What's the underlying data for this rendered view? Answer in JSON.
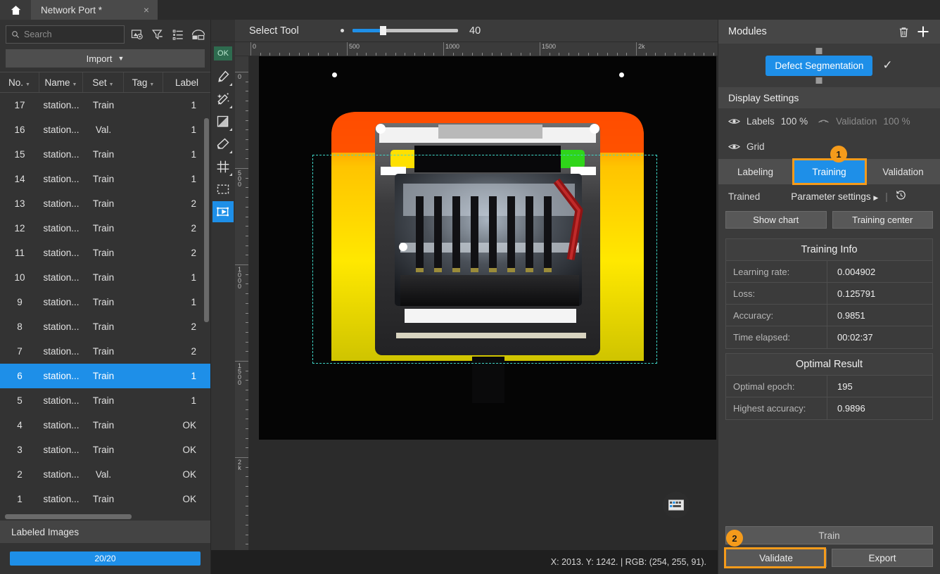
{
  "window": {
    "home_icon": "home-icon",
    "tab_title": "Network Port *",
    "tab_close": "×"
  },
  "sidebar": {
    "search": {
      "placeholder": "Search",
      "value": "",
      "icon": "search-icon"
    },
    "toolbar_icons": [
      "image-settings-icon",
      "filter-icon",
      "list-view-icon",
      "layout-view-icon"
    ],
    "import_label": "Import",
    "import_caret": "▼",
    "columns": [
      "No.",
      "Name",
      "Set",
      "Tag",
      "Label"
    ],
    "rows": [
      {
        "no": "1",
        "name": "station...",
        "set": "Train",
        "tag": "",
        "label": "OK"
      },
      {
        "no": "2",
        "name": "station...",
        "set": "Val.",
        "tag": "",
        "label": "OK"
      },
      {
        "no": "3",
        "name": "station...",
        "set": "Train",
        "tag": "",
        "label": "OK"
      },
      {
        "no": "4",
        "name": "station...",
        "set": "Train",
        "tag": "",
        "label": "OK"
      },
      {
        "no": "5",
        "name": "station...",
        "set": "Train",
        "tag": "",
        "label": "1"
      },
      {
        "no": "6",
        "name": "station...",
        "set": "Train",
        "tag": "",
        "label": "1"
      },
      {
        "no": "7",
        "name": "station...",
        "set": "Train",
        "tag": "",
        "label": "2"
      },
      {
        "no": "8",
        "name": "station...",
        "set": "Train",
        "tag": "",
        "label": "2"
      },
      {
        "no": "9",
        "name": "station...",
        "set": "Train",
        "tag": "",
        "label": "1"
      },
      {
        "no": "10",
        "name": "station...",
        "set": "Train",
        "tag": "",
        "label": "1"
      },
      {
        "no": "11",
        "name": "station...",
        "set": "Train",
        "tag": "",
        "label": "2"
      },
      {
        "no": "12",
        "name": "station...",
        "set": "Train",
        "tag": "",
        "label": "2"
      },
      {
        "no": "13",
        "name": "station...",
        "set": "Train",
        "tag": "",
        "label": "2"
      },
      {
        "no": "14",
        "name": "station...",
        "set": "Train",
        "tag": "",
        "label": "1"
      },
      {
        "no": "15",
        "name": "station...",
        "set": "Train",
        "tag": "",
        "label": "1"
      },
      {
        "no": "16",
        "name": "station...",
        "set": "Val.",
        "tag": "",
        "label": "1"
      },
      {
        "no": "17",
        "name": "station...",
        "set": "Train",
        "tag": "",
        "label": "1"
      }
    ],
    "selected_row_index": 5,
    "labeled_images_title": "Labeled Images",
    "labeled_progress_text": "20/20"
  },
  "toolbar": {
    "tool_name": "Select Tool",
    "brush_size": "40",
    "slider_percent": 28
  },
  "left_tools": {
    "ok_badge": "OK",
    "items": [
      {
        "icon": "brush-icon",
        "active": false
      },
      {
        "icon": "magic-wand-icon",
        "active": false
      },
      {
        "icon": "gradient-fill-icon",
        "active": false
      },
      {
        "icon": "eraser-icon",
        "active": false
      },
      {
        "icon": "grid-tool-icon",
        "active": false
      },
      {
        "icon": "marquee-select-icon",
        "active": false
      },
      {
        "icon": "move-select-icon",
        "active": true
      }
    ]
  },
  "rulers": {
    "horizontal_labels": [
      "0",
      "500",
      "1000",
      "1500",
      "2k"
    ],
    "vertical_labels": [
      "0",
      "500",
      "1000",
      "1500",
      "2k"
    ]
  },
  "canvas": {
    "status_text": "X: 2013. Y: 1242. | RGB: (254, 255, 91).",
    "keyboard_icon": "keyboard-icon",
    "selection_color": "#3fd6c8",
    "defect_color": "#8f1414"
  },
  "right": {
    "panel_title": "Modules",
    "delete_icon": "trash-icon",
    "add_icon": "plus-icon",
    "module_chip": "Defect Segmentation",
    "module_check": "✓",
    "display_settings_title": "Display Settings",
    "display_rows": {
      "labels_name": "Labels",
      "labels_value": "100 %",
      "validation_name": "Validation",
      "validation_value": "100 %",
      "grid_name": "Grid",
      "eye_icon": "eye-icon",
      "eye_off_icon": "eye-off-icon"
    },
    "tabs": [
      "Labeling",
      "Training",
      "Validation"
    ],
    "active_tab": "Training",
    "trained_label": "Trained",
    "parameter_settings": "Parameter settings",
    "parameter_caret": "▶",
    "history_icon": "history-icon",
    "show_chart": "Show chart",
    "training_center": "Training center",
    "training_info": {
      "title": "Training Info",
      "rows": [
        {
          "key": "Learning rate:",
          "value": "0.004902"
        },
        {
          "key": "Loss:",
          "value": "0.125791"
        },
        {
          "key": "Accuracy:",
          "value": "0.9851"
        },
        {
          "key": "Time elapsed:",
          "value": "00:02:37"
        }
      ]
    },
    "optimal_result": {
      "title": "Optimal Result",
      "rows": [
        {
          "key": "Optimal epoch:",
          "value": "195"
        },
        {
          "key": "Highest accuracy:",
          "value": "0.9896"
        }
      ]
    },
    "actions": {
      "train": "Train",
      "validate": "Validate",
      "export": "Export"
    }
  },
  "annotations": {
    "badge1": "1",
    "badge2": "2",
    "highlight_color": "#f59b1b"
  },
  "colors": {
    "accent_blue": "#1e8fe8",
    "panel_bg": "#3b3b3b",
    "sidebar_bg": "#333333",
    "header_bg": "#464646",
    "highlight": "#f59b1b"
  }
}
